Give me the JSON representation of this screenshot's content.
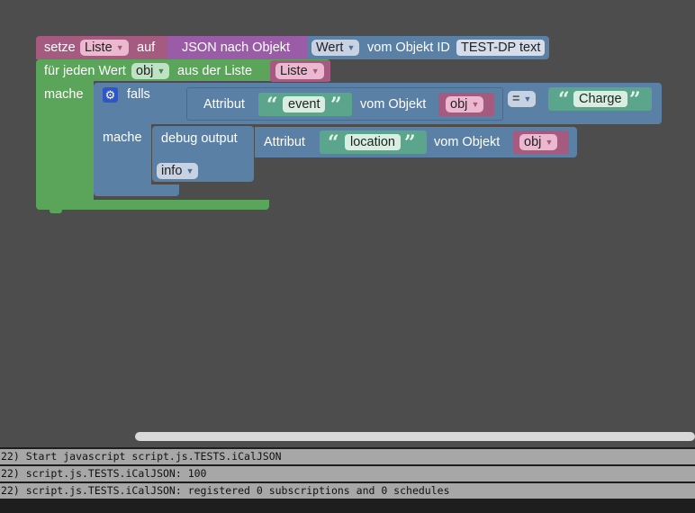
{
  "blocks": {
    "set_block": {
      "label_set": "setze",
      "var_dropdown": "Liste",
      "label_to": "auf",
      "json_label": "JSON nach Objekt",
      "value_dropdown": "Wert",
      "from_object_label": "vom Objekt ID",
      "object_id": "TEST-DP text"
    },
    "foreach_block": {
      "label": "für jeden Wert",
      "var_dropdown": "obj",
      "label_from": "aus der Liste",
      "list_dropdown": "Liste",
      "do_label": "mache"
    },
    "if_block": {
      "label_if": "falls",
      "do_label": "mache",
      "attr_label": "Attribut",
      "attr_value": "event",
      "from_object_label": "vom Objekt",
      "obj_dropdown": "obj",
      "operator": "=",
      "compare_value": "Charge"
    },
    "debug_block": {
      "label": "debug output",
      "attr_label": "Attribut",
      "attr_value": "location",
      "from_object_label": "vom Objekt",
      "obj_dropdown": "obj",
      "level_dropdown": "info"
    },
    "quote_open": "“",
    "quote_close": "”",
    "dropdown_arrow": "▼"
  },
  "console": {
    "lines": [
      "22) Start javascript script.js.TESTS.iCalJSON",
      "22) script.js.TESTS.iCalJSON: 100",
      "22) script.js.TESTS.iCalJSON: registered 0 subscriptions and 0 schedules"
    ]
  },
  "colors": {
    "background": "#4d4d4d",
    "variable_block": "#a55b80",
    "json_block": "#9a5ca6",
    "object_block": "#5b80a5",
    "loop_block": "#5ba55b",
    "logic_block": "#5b80a5",
    "string_block": "#5ba58c",
    "console_line": "#a7a7a7"
  }
}
